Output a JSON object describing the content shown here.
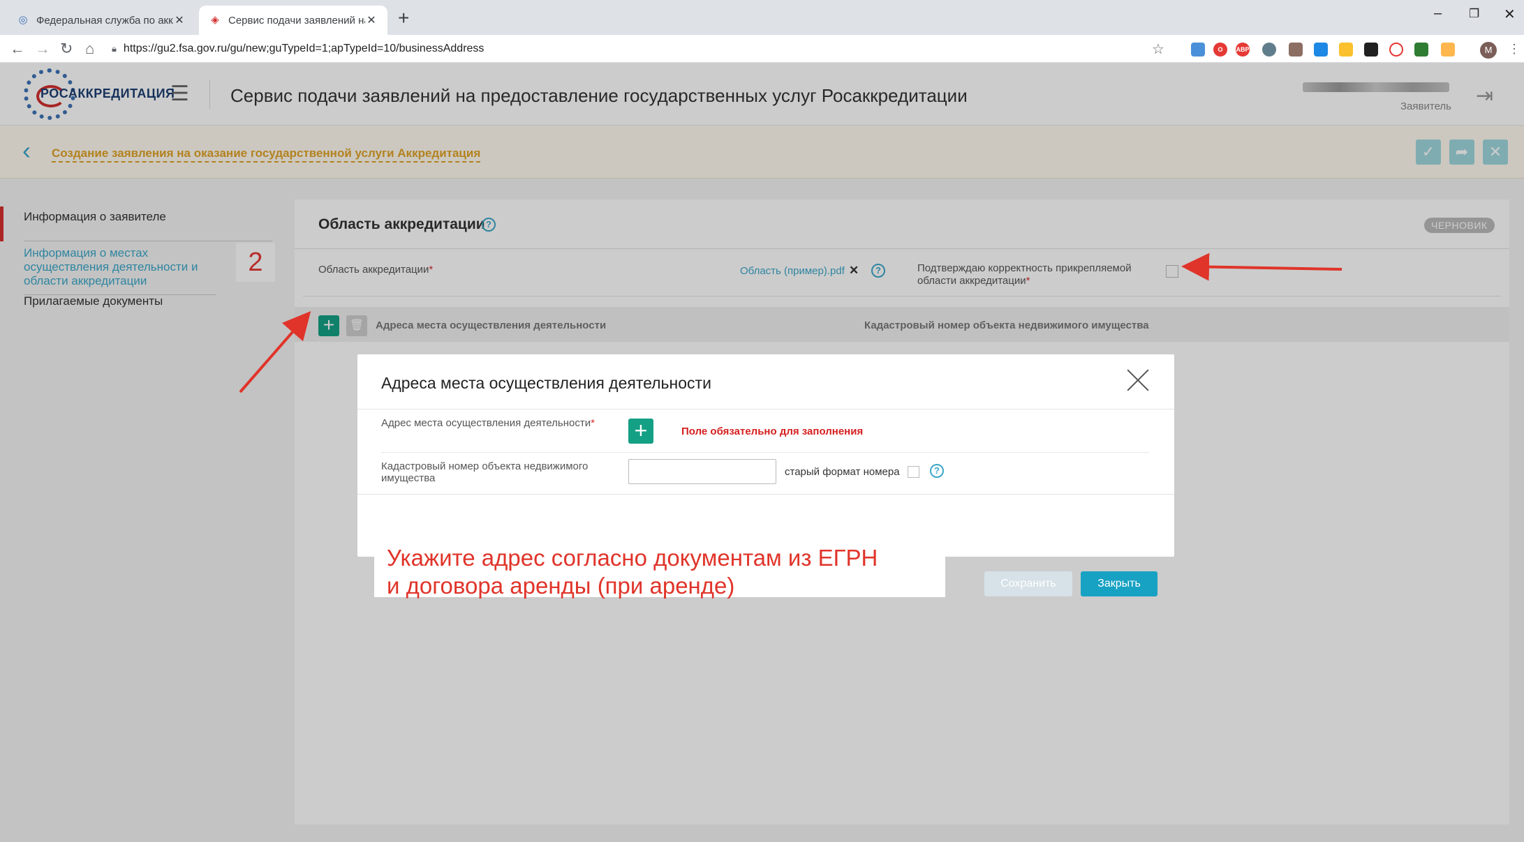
{
  "browser": {
    "tabs": [
      {
        "title": "Федеральная служба по аккред",
        "active": false
      },
      {
        "title": "Сервис подачи заявлений на п",
        "active": true
      }
    ],
    "url": "https://gu2.fsa.gov.ru/gu/new;guTypeId=1;apTypeId=10/businessAddress",
    "profile_initial": "M"
  },
  "header": {
    "logo_text": "РОСАККРЕДИТАЦИЯ",
    "title": "Сервис подачи заявлений на предоставление государственных услуг Росаккредитации",
    "user_role": "Заявитель"
  },
  "breadcrumb": {
    "text": "Создание заявления на оказание государственной услуги Аккредитация"
  },
  "sidebar": {
    "items": [
      {
        "label": "Информация о заявителе"
      },
      {
        "label": "Информация о местах осуществления деятельности и области аккредитации"
      },
      {
        "label": "Прилагаемые документы"
      }
    ],
    "step_badge": "2"
  },
  "panel": {
    "title": "Область аккредитации",
    "status": "ЧЕРНОВИК",
    "field_label": "Область аккредитации",
    "required_mark": "*",
    "file_name": "Область (пример).pdf",
    "confirm_label": "Подтверждаю корректность прикрепляемой области аккредитации",
    "columns": [
      "Адреса места осуществления деятельности",
      "Кадастровый номер объекта недвижимого имущества"
    ]
  },
  "modal": {
    "title": "Адреса места осуществления деятельности",
    "address_label": "Адрес места осуществления деятельности",
    "required_mark": "*",
    "required_message": "Поле обязательно для заполнения",
    "cadastral_label": "Кадастровый номер объекта недвижимого имущества",
    "cadastral_value": "",
    "old_format_label": "старый формат номера",
    "save_label": "Сохранить",
    "close_label": "Закрыть"
  },
  "annotation": {
    "text": "Укажите адрес согласно документам из ЕГРН\nи договора аренды (при аренде)"
  },
  "colors": {
    "accent": "#3ba7c9",
    "green": "#14a085",
    "error": "#d61f1f",
    "annotation": "#e0342a",
    "breadcrumb": "#e0a327"
  }
}
